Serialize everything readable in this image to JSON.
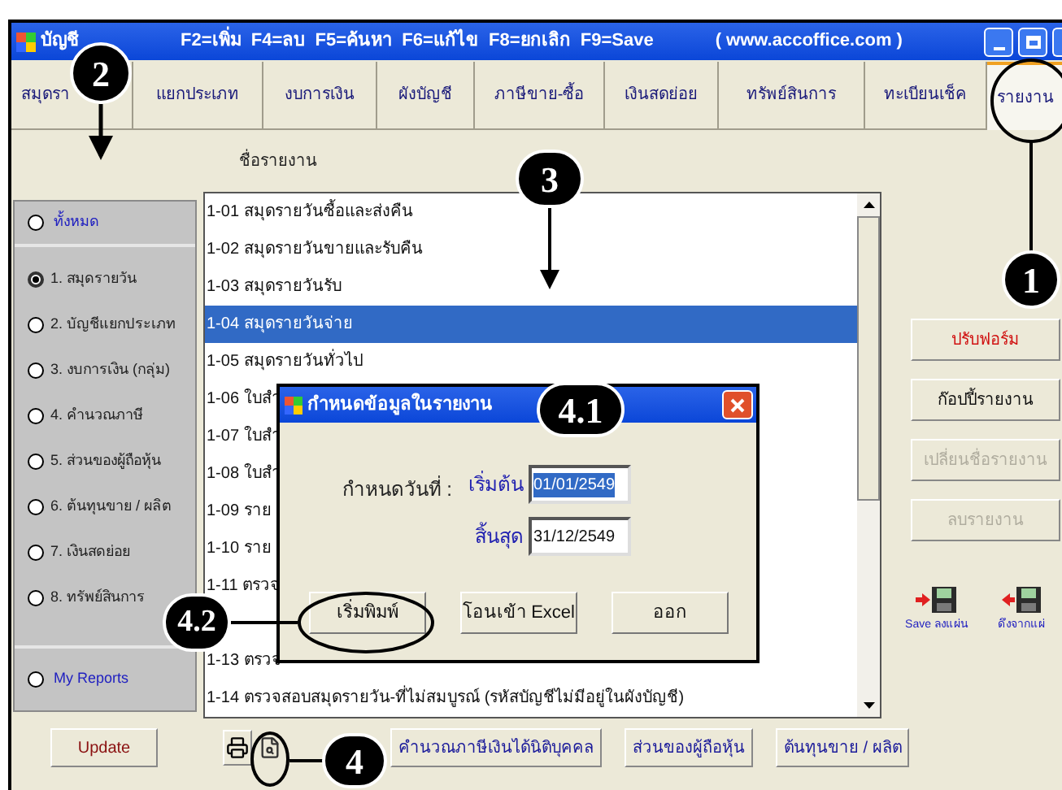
{
  "window": {
    "title": "บัญชี",
    "shortcuts": "F2=เพิ่ม  F4=ลบ  F5=ค้นหา  F6=แก้ไข  F8=ยกเลิก  F9=Save",
    "website": "( www.accoffice.com )"
  },
  "tabs": [
    {
      "label": "สมุดรา",
      "selected": false
    },
    {
      "label": "แยกประเภท",
      "selected": false
    },
    {
      "label": "งบการเงิน",
      "selected": false
    },
    {
      "label": "ผังบัญชี",
      "selected": false
    },
    {
      "label": "ภาษีขาย-ซื้อ",
      "selected": false
    },
    {
      "label": "เงินสดย่อย",
      "selected": false
    },
    {
      "label": "ทรัพย์สินการ",
      "selected": false
    },
    {
      "label": "ทะเบียนเช็ค",
      "selected": false
    },
    {
      "label": "รายงาน",
      "selected": true
    }
  ],
  "sidebar": {
    "all": {
      "label": "ทั้งหมด",
      "selected": false
    },
    "items": [
      {
        "label": "1. สมุดรายวัน",
        "selected": true
      },
      {
        "label": "2. บัญชีแยกประเภท",
        "selected": false
      },
      {
        "label": "3. งบการเงิน (กลุ่ม)",
        "selected": false
      },
      {
        "label": "4. คำนวณภาษี",
        "selected": false
      },
      {
        "label": "5. ส่วนของผู้ถือหุ้น",
        "selected": false
      },
      {
        "label": "6. ต้นทุนขาย / ผลิต",
        "selected": false
      },
      {
        "label": "7. เงินสดย่อย",
        "selected": false
      },
      {
        "label": "8. ทรัพย์สินการ",
        "selected": false
      }
    ],
    "my_reports": {
      "label": "My Reports",
      "selected": false
    }
  },
  "report_list": {
    "header": "ชื่อรายงาน",
    "rows": [
      {
        "kind": "text",
        "text": "1-01 สมุดรายวันซื้อและส่งคืน",
        "selected": false
      },
      {
        "kind": "text",
        "text": "1-02 สมุดรายวันขายและรับคืน",
        "selected": false
      },
      {
        "kind": "text",
        "text": "1-03 สมุดรายวันรับ",
        "selected": false
      },
      {
        "kind": "text",
        "text": "1-04 สมุดรายวันจ่าย",
        "selected": true
      },
      {
        "kind": "text",
        "text": "1-05 สมุดรายวันทั่วไป",
        "selected": false
      },
      {
        "kind": "text",
        "text": "1-06 ใบสำ",
        "selected": false
      },
      {
        "kind": "text",
        "text": "1-07 ใบสำ",
        "selected": false
      },
      {
        "kind": "text",
        "text": "1-08 ใบสำ",
        "selected": false
      },
      {
        "kind": "text",
        "text": "1-09 ราย",
        "selected": false
      },
      {
        "kind": "text",
        "text": "1-10 ราย",
        "selected": false
      },
      {
        "kind": "text",
        "text": "1-11 ตรวจ",
        "selected": false
      },
      {
        "kind": "covered",
        "selected": false
      },
      {
        "kind": "text",
        "text": "1-13 ตรวจ",
        "selected": false
      },
      {
        "kind": "text",
        "text": "1-14 ตรวจสอบสมุดรายวัน-ที่ไม่สมบูรณ์ (รหัสบัญชีไม่มีอยู่ในผังบัญชี)",
        "selected": false
      }
    ]
  },
  "side_buttons": [
    {
      "label": "ปรับฟอร์ม",
      "disabled": false,
      "kind": "accent"
    },
    {
      "label": "ก๊อปปี้รายงาน",
      "disabled": false,
      "kind": "normal"
    },
    {
      "label": "เปลี่ยนชื่อรายงาน",
      "disabled": true,
      "kind": "normal"
    },
    {
      "label": "ลบรายงาน",
      "disabled": true,
      "kind": "normal"
    }
  ],
  "disk_buttons": [
    {
      "label": "Save ลงแผ่น",
      "kind": "save"
    },
    {
      "label": "ดึงจากแผ่",
      "kind": "load"
    }
  ],
  "bottom_bar": {
    "update": "Update",
    "buttons": [
      "คำนวณภาษีเงินได้นิติบุคคล",
      "ส่วนของผู้ถือหุ้น",
      "ต้นทุนขาย / ผลิต"
    ]
  },
  "dialog": {
    "title": "กำหนดข้อมูลในรายงาน",
    "date_label": "กำหนดวันที่ :",
    "fields": [
      {
        "label": "เริ่มต้น",
        "value": "01/01/2549",
        "selected": true
      },
      {
        "label": "สิ้นสุด",
        "value": "31/12/2549",
        "selected": false
      }
    ],
    "buttons": [
      "เริ่มพิมพ์",
      "โอนเข้า Excel",
      "ออก"
    ]
  },
  "callouts": [
    {
      "label": "1"
    },
    {
      "label": "2"
    },
    {
      "label": "3"
    },
    {
      "label": "4.1"
    },
    {
      "label": "4.2"
    },
    {
      "label": "4"
    }
  ]
}
